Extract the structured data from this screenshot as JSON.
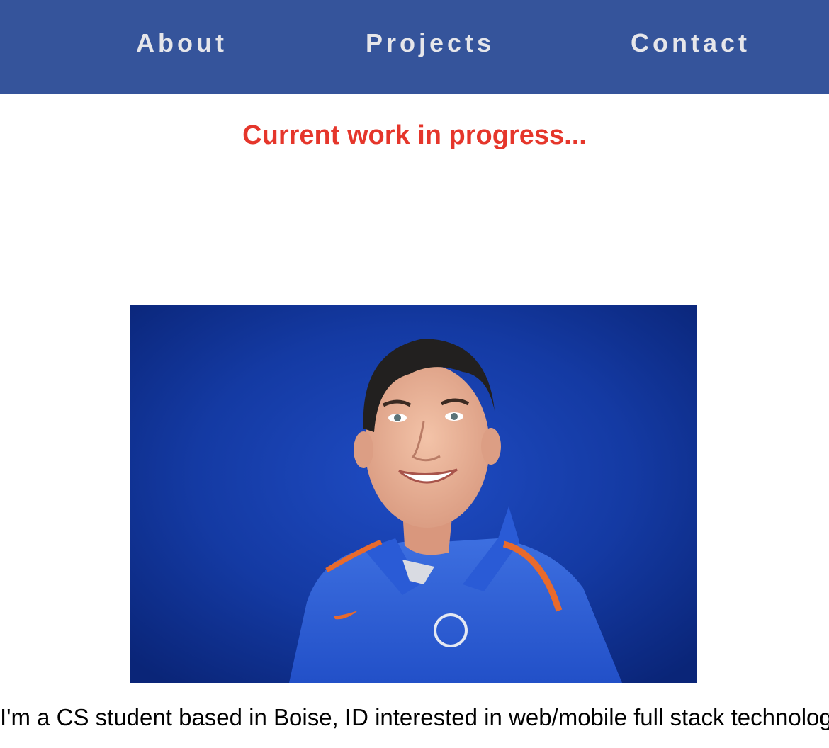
{
  "nav": {
    "items": [
      {
        "label": "About"
      },
      {
        "label": "Projects"
      },
      {
        "label": "Contact"
      }
    ],
    "background_color": "#35549b",
    "text_color": "#e6e6ea"
  },
  "main": {
    "status_heading": "Current work in progress...",
    "status_color": "#e5362b",
    "bio": "I'm a CS student based in Boise, ID interested in web/mobile full stack technology."
  }
}
